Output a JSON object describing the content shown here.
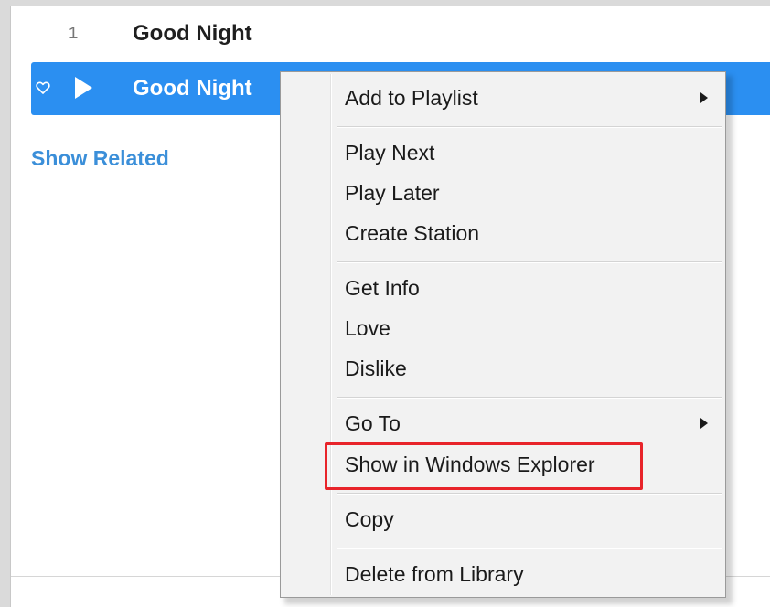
{
  "tracks": [
    {
      "number": "1",
      "title": "Good Night"
    },
    {
      "number": "",
      "title": "Good Night"
    }
  ],
  "show_related_label": "Show Related",
  "context_menu": {
    "items": {
      "add_to_playlist": "Add to Playlist",
      "play_next": "Play Next",
      "play_later": "Play Later",
      "create_station": "Create Station",
      "get_info": "Get Info",
      "love": "Love",
      "dislike": "Dislike",
      "go_to": "Go To",
      "show_in_windows_explorer": "Show in Windows Explorer",
      "copy": "Copy",
      "delete_from_library": "Delete from Library"
    },
    "highlighted_item": "Show in Windows Explorer"
  },
  "icons": {
    "heart": "heart-outline-icon",
    "play": "play-icon",
    "submenu": "chevron-right-icon"
  },
  "colors": {
    "selection": "#2b8ff1",
    "link": "#3b8fd9",
    "highlight_box": "#e8242a",
    "menu_background": "#f2f2f2"
  }
}
